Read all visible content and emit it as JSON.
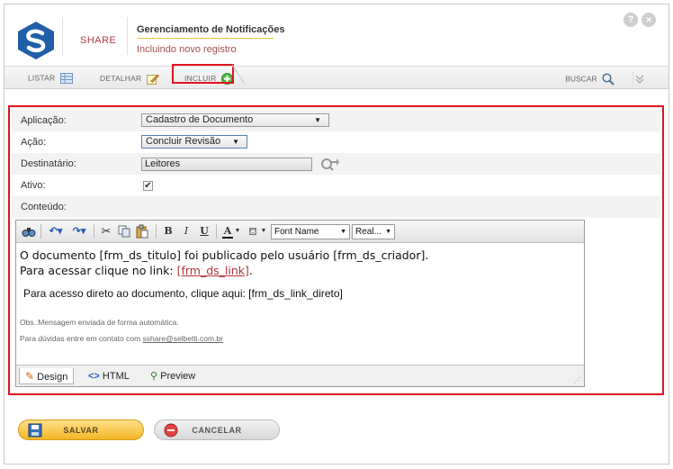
{
  "header": {
    "brand": "SHARE",
    "title": "Gerenciamento de Notificações",
    "subtitle": "Incluindo novo registro",
    "help_glyph": "?",
    "close_glyph": "✕"
  },
  "toolbar": {
    "listar": "LISTAR",
    "detalhar": "DETALHAR",
    "incluir": "INCLUIR",
    "buscar": "BUSCAR"
  },
  "form": {
    "aplicacao_label": "Aplicação:",
    "aplicacao_value": "Cadastro de Documento",
    "acao_label": "Ação:",
    "acao_value": "Concluir Revisão",
    "destinatario_label": "Destinatário:",
    "destinatario_value": "Leitores",
    "ativo_label": "Ativo:",
    "ativo_checked": "✔",
    "conteudo_label": "Conteúdo:"
  },
  "editor": {
    "font_name": "Font Name",
    "font_size": "Real...",
    "bold": "B",
    "italic": "I",
    "underline": "U",
    "font_color": "A",
    "content": {
      "line1": "O documento [frm_ds_titulo] foi publicado pelo usuário [frm_ds_criador].",
      "line2_prefix": "Para acessar clique no link: ",
      "line2_link": "[frm_ds_link]",
      "line2_suffix": ".",
      "line3": "Para acesso direto ao documento, clique aqui: [frm_ds_link_direto]",
      "obs": "Obs.:Mensagem enviada de forma automática.",
      "contact_prefix": "Para dúvidas entre em contato com ",
      "contact_email": "sshare@selbetti.com.br"
    },
    "modes": {
      "design": "Design",
      "html": "HTML",
      "preview": "Preview"
    }
  },
  "actions": {
    "save": "SALVAR",
    "cancel": "CANCELAR"
  },
  "colors": {
    "highlight": "#e0141e",
    "brand": "#b23a48",
    "logo_blue": "#1f5fa8",
    "save_button": "#f3b624"
  }
}
